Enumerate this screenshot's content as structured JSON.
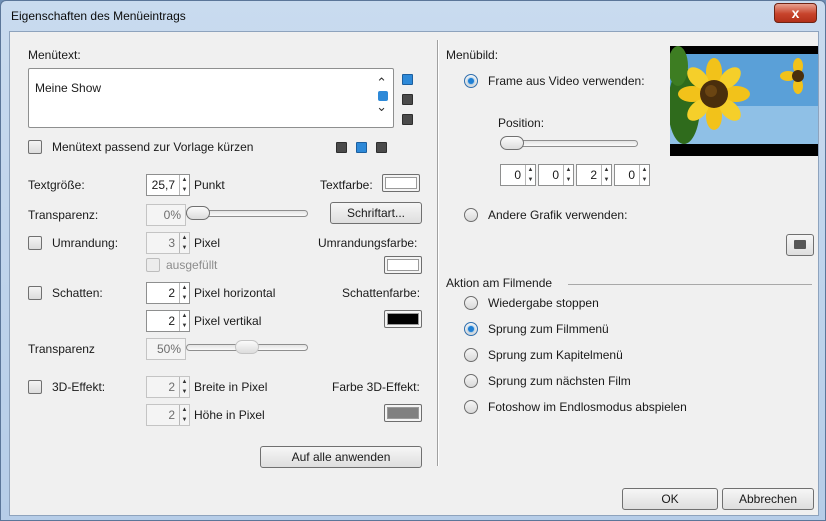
{
  "window": {
    "title": "Eigenschaften des Menüeintrags",
    "close_glyph": "x"
  },
  "left": {
    "menutext_label": "Menütext:",
    "menutext_value": "Meine Show",
    "shorten_label": "Menütext passend zur Vorlage kürzen",
    "textsize_label": "Textgröße:",
    "textsize_value": "25,7",
    "textsize_unit": "Punkt",
    "textcolor_label": "Textfarbe:",
    "textcolor": "#ffffff",
    "transparency_label": "Transparenz:",
    "transparency_value": "0%",
    "transparency_level": 0,
    "font_button": "Schriftart...",
    "outline_label": "Umrandung:",
    "outline_value": "3",
    "outline_unit": "Pixel",
    "outline_filled": "ausgefüllt",
    "outline_color_label": "Umrandungsfarbe:",
    "outline_color": "#ffffff",
    "shadow_label": "Schatten:",
    "shadow_h_value": "2",
    "shadow_h_unit": "Pixel horizontal",
    "shadow_v_value": "2",
    "shadow_v_unit": "Pixel vertikal",
    "shadow_color_label": "Schattenfarbe:",
    "shadow_color": "#000000",
    "shadow_transparency_label": "Transparenz",
    "shadow_transparency_value": "50%",
    "shadow_transparency_level": 0.5,
    "effect3d_label": "3D-Effekt:",
    "effect3d_width_value": "2",
    "effect3d_width_unit": "Breite in Pixel",
    "effect3d_height_value": "2",
    "effect3d_height_unit": "Höhe in Pixel",
    "effect3d_color_label": "Farbe 3D-Effekt:",
    "effect3d_color": "#808080",
    "apply_all_button": "Auf alle anwenden"
  },
  "right": {
    "menubild_label": "Menübild:",
    "frame_option": "Frame aus Video verwenden:",
    "position_label": "Position:",
    "timecode": [
      "0",
      "0",
      "2",
      "0"
    ],
    "other_graphic_option": "Andere Grafik verwenden:",
    "action_header": "Aktion am Filmende",
    "actions": [
      "Wiedergabe stoppen",
      "Sprung zum Filmmenü",
      "Sprung zum Kapitelmenü",
      "Sprung zum nächsten Film",
      "Fotoshow im Endlosmodus abspielen"
    ],
    "selected_action": 1
  },
  "footer": {
    "ok": "OK",
    "cancel": "Abbrechen"
  },
  "colors": {
    "accent": "#1f7fd4",
    "title_bar": "#c9dbef"
  }
}
